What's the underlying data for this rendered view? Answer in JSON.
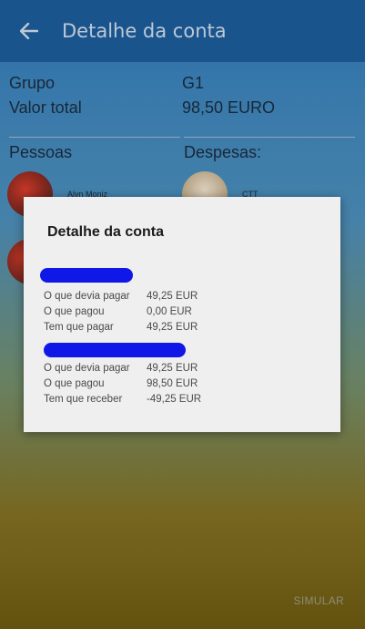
{
  "appbar": {
    "title": "Detalhe da conta"
  },
  "summary": [
    {
      "key": "Grupo",
      "value": "G1"
    },
    {
      "key": "Valor total",
      "value": "98,50 EURO"
    }
  ],
  "columns": {
    "people_header": "Pessoas",
    "expenses_header": "Despesas:"
  },
  "people": [
    {
      "name": "Alyn Moniz"
    }
  ],
  "expenses": [
    {
      "name": "CTT"
    }
  ],
  "dialog": {
    "title": "Detalhe da conta",
    "sections": [
      {
        "lines": [
          {
            "label": "O que devia pagar",
            "value": "49,25 EUR"
          },
          {
            "label": "O que pagou",
            "value": "0,00 EUR"
          },
          {
            "label": "Tem que pagar",
            "value": "49,25 EUR"
          }
        ]
      },
      {
        "lines": [
          {
            "label": "O que devia pagar",
            "value": "49,25 EUR"
          },
          {
            "label": "O que pagou",
            "value": "98,50 EUR"
          },
          {
            "label": "Tem que receber",
            "value": "-49,25 EUR"
          }
        ]
      }
    ]
  },
  "footer": {
    "simulate_label": "SIMULAR"
  }
}
